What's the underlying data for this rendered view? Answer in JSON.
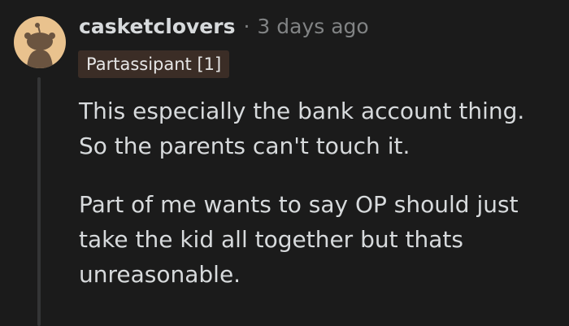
{
  "comment": {
    "avatar": {
      "icon": "snoo-avatar-icon",
      "background_color": "#e9c28e"
    },
    "username": "casketclovers",
    "separator": "·",
    "timestamp": "3 days ago",
    "flair": "Partassipant [1]",
    "paragraphs": [
      "This especially the bank account thing. So the parents can't touch it.",
      "Part of me wants to say OP should just take the kid all together but thats unreasonable."
    ]
  },
  "colors": {
    "background": "#1b1b1b",
    "text": "#d7dadc",
    "muted": "#818384",
    "flair_background": "#3b2d26",
    "thread_line": "#343536"
  }
}
